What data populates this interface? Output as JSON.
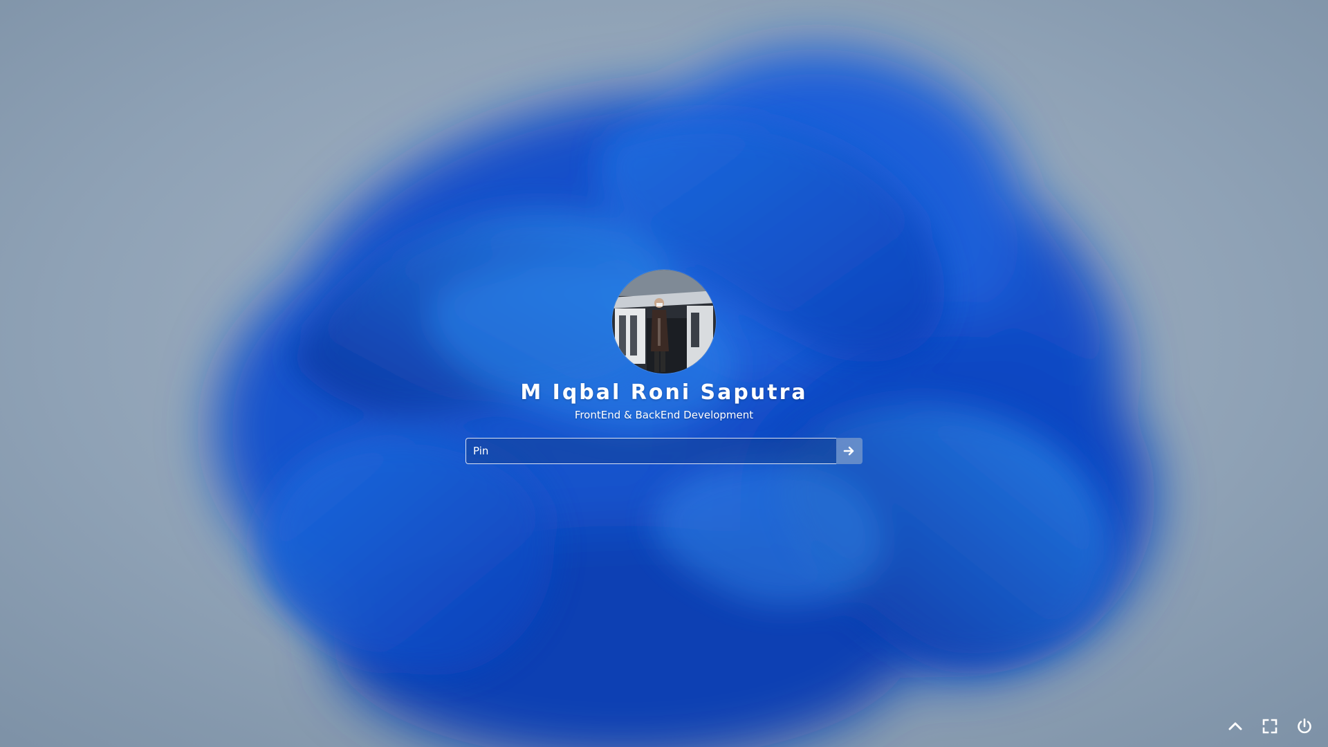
{
  "lock_screen": {
    "user_name": "M Iqbal Roni Saputra",
    "user_subtitle": "FrontEnd & BackEnd Development",
    "pin_placeholder": "Pin",
    "pin_value": ""
  },
  "icons": {
    "avatar": "avatar-photo",
    "submit": "arrow-right-icon",
    "tray": [
      "chevron-up-icon",
      "fullscreen-icon",
      "power-icon"
    ]
  },
  "colors": {
    "background": "#8b9db0",
    "accent_blue": "#1a5bd6",
    "text": "#ffffff"
  }
}
